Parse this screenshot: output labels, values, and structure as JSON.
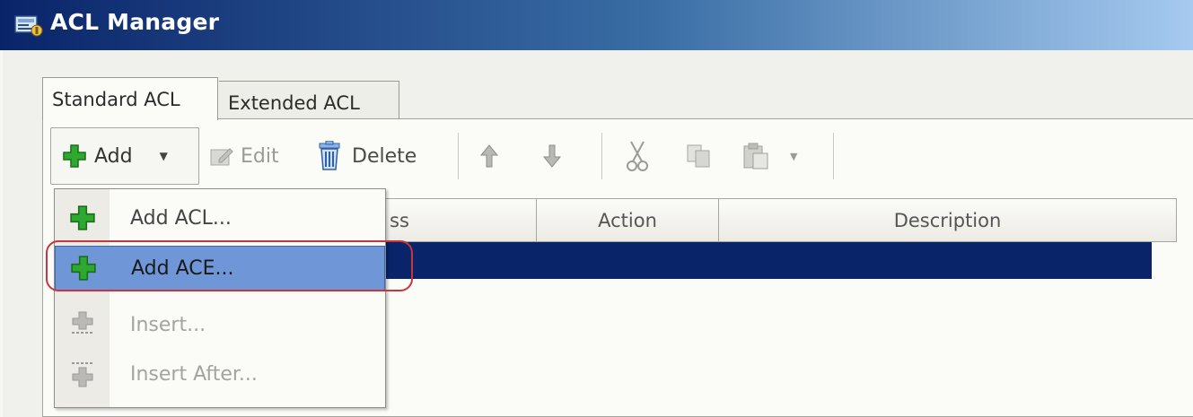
{
  "window": {
    "title": "ACL Manager",
    "icon": "acl-manager-icon"
  },
  "tabs": [
    {
      "label": "Standard ACL",
      "selected": true
    },
    {
      "label": "Extended ACL",
      "selected": false
    }
  ],
  "toolbar": {
    "add_label": "Add",
    "edit_label": "Edit",
    "delete_label": "Delete",
    "icons": [
      "plus-icon",
      "dropdown-arrow-icon",
      "edit-icon",
      "trash-icon",
      "move-up-icon",
      "move-down-icon",
      "cut-icon",
      "copy-icon",
      "paste-icon",
      "dropdown-arrow-icon"
    ]
  },
  "table": {
    "columns": [
      "ss",
      "Action",
      "Description"
    ]
  },
  "menu": {
    "items": [
      {
        "label": "Add ACL...",
        "icon": "plus-icon",
        "enabled": true
      },
      {
        "label": "Add ACE...",
        "icon": "plus-icon",
        "enabled": true,
        "highlighted": true
      },
      {
        "label": "Insert...",
        "icon": "insert-icon",
        "enabled": false
      },
      {
        "label": "Insert After...",
        "icon": "insert-after-icon",
        "enabled": false
      }
    ]
  },
  "colors": {
    "title_bar": "#0a246a",
    "selected_row": "#0a246a",
    "menu_highlight": "#6f97d8",
    "annotation_ring": "#c8353a",
    "plus_green": "#2fa82f"
  }
}
